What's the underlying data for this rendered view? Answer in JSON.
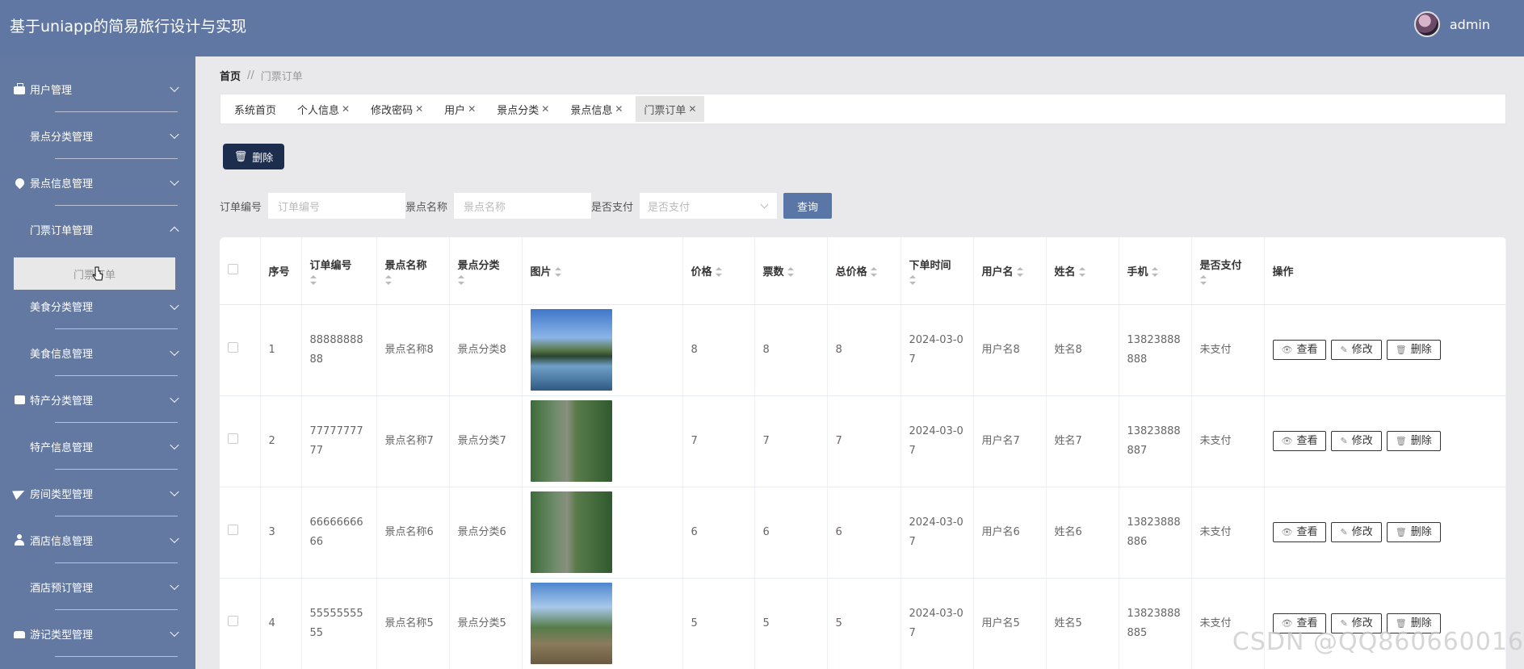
{
  "header": {
    "title": "基于uniapp的简易旅行设计与实现",
    "user_name": "admin"
  },
  "sidebar": {
    "items": [
      {
        "label": "用户管理",
        "icon": "briefcase-icon",
        "expanded": false
      },
      {
        "label": "景点分类管理",
        "icon": "grid-icon",
        "expanded": false
      },
      {
        "label": "景点信息管理",
        "icon": "pin-icon",
        "expanded": false
      },
      {
        "label": "门票订单管理",
        "icon": "sliders-icon",
        "expanded": true
      },
      {
        "label": "美食分类管理",
        "icon": "grid-icon",
        "expanded": false
      },
      {
        "label": "美食信息管理",
        "icon": "grid-icon",
        "expanded": false
      },
      {
        "label": "特产分类管理",
        "icon": "printer-icon",
        "expanded": false
      },
      {
        "label": "特产信息管理",
        "icon": "grid-icon",
        "expanded": false
      },
      {
        "label": "房间类型管理",
        "icon": "plane-icon",
        "expanded": false
      },
      {
        "label": "酒店信息管理",
        "icon": "user-icon",
        "expanded": false
      },
      {
        "label": "酒店预订管理",
        "icon": "grid-icon",
        "expanded": false
      },
      {
        "label": "游记类型管理",
        "icon": "car-icon",
        "expanded": false
      }
    ],
    "submenu_label": "门票订单"
  },
  "breadcrumb": {
    "home": "首页",
    "separator": "//",
    "current": "门票订单"
  },
  "tabs": [
    {
      "label": "系统首页",
      "closable": false,
      "active": false
    },
    {
      "label": "个人信息",
      "closable": true,
      "active": false
    },
    {
      "label": "修改密码",
      "closable": true,
      "active": false
    },
    {
      "label": "用户",
      "closable": true,
      "active": false
    },
    {
      "label": "景点分类",
      "closable": true,
      "active": false
    },
    {
      "label": "景点信息",
      "closable": true,
      "active": false
    },
    {
      "label": "门票订单",
      "closable": true,
      "active": true
    }
  ],
  "toolbar": {
    "delete_label": "删除"
  },
  "search": {
    "order_no_label": "订单编号",
    "order_no_placeholder": "订单编号",
    "spot_name_label": "景点名称",
    "spot_name_placeholder": "景点名称",
    "paid_label": "是否支付",
    "paid_placeholder": "是否支付",
    "query_label": "查询"
  },
  "table": {
    "columns": [
      "序号",
      "订单编号",
      "景点名称",
      "景点分类",
      "图片",
      "价格",
      "票数",
      "总价格",
      "下单时间",
      "用户名",
      "姓名",
      "手机",
      "是否支付",
      "操作"
    ],
    "rows": [
      {
        "index": "1",
        "order_no": "8888888888",
        "spot_name": "景点名称8",
        "category": "景点分类8",
        "price": "8",
        "tickets": "8",
        "total": "8",
        "time": "2024-03-07",
        "username": "用户名8",
        "name": "姓名8",
        "phone": "13823888888",
        "paid": "未支付"
      },
      {
        "index": "2",
        "order_no": "7777777777",
        "spot_name": "景点名称7",
        "category": "景点分类7",
        "price": "7",
        "tickets": "7",
        "total": "7",
        "time": "2024-03-07",
        "username": "用户名7",
        "name": "姓名7",
        "phone": "13823888887",
        "paid": "未支付"
      },
      {
        "index": "3",
        "order_no": "6666666666",
        "spot_name": "景点名称6",
        "category": "景点分类6",
        "price": "6",
        "tickets": "6",
        "total": "6",
        "time": "2024-03-07",
        "username": "用户名6",
        "name": "姓名6",
        "phone": "13823888886",
        "paid": "未支付"
      },
      {
        "index": "4",
        "order_no": "5555555555",
        "spot_name": "景点名称5",
        "category": "景点分类5",
        "price": "5",
        "tickets": "5",
        "total": "5",
        "time": "2024-03-07",
        "username": "用户名5",
        "name": "姓名5",
        "phone": "13823888885",
        "paid": "未支付"
      }
    ],
    "actions": {
      "view": "查看",
      "edit": "修改",
      "delete": "删除"
    }
  },
  "watermark": "CSDN @QQ860660016",
  "colors": {
    "header_bg": "#6077a3",
    "sidebar_bg": "#6479a2",
    "delete_button_bg": "#1c2d4d",
    "query_button_bg": "#5a76a6"
  }
}
